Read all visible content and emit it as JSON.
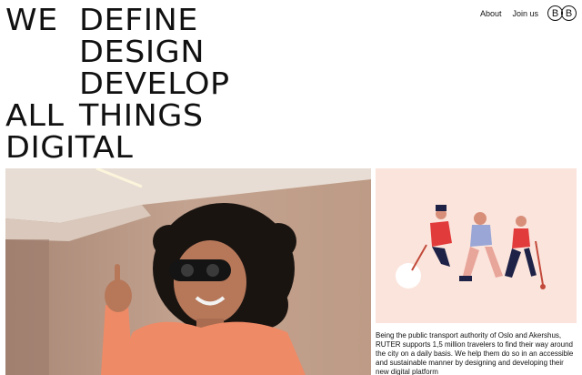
{
  "hero": {
    "we": "WE",
    "define": "DEFINE",
    "design": "DESIGN",
    "develop": "DEVELOP",
    "all": "ALL",
    "things": "THINGS",
    "digital": "DIGITAL"
  },
  "nav": {
    "about": "About",
    "join": "Join us",
    "logo_letters": [
      "B",
      "B"
    ]
  },
  "case": {
    "caption": "Being the public transport authority of Oslo and Akershus, RUTER supports 1,5 million travelers to find their way around the city on a daily basis. We help them do so in an accessible and sustainable manner by designing and developing their new digital platform"
  },
  "colors": {
    "illustration_bg": "#fbe4dc",
    "accent_red": "#e23b3b",
    "navy": "#1d2246"
  }
}
